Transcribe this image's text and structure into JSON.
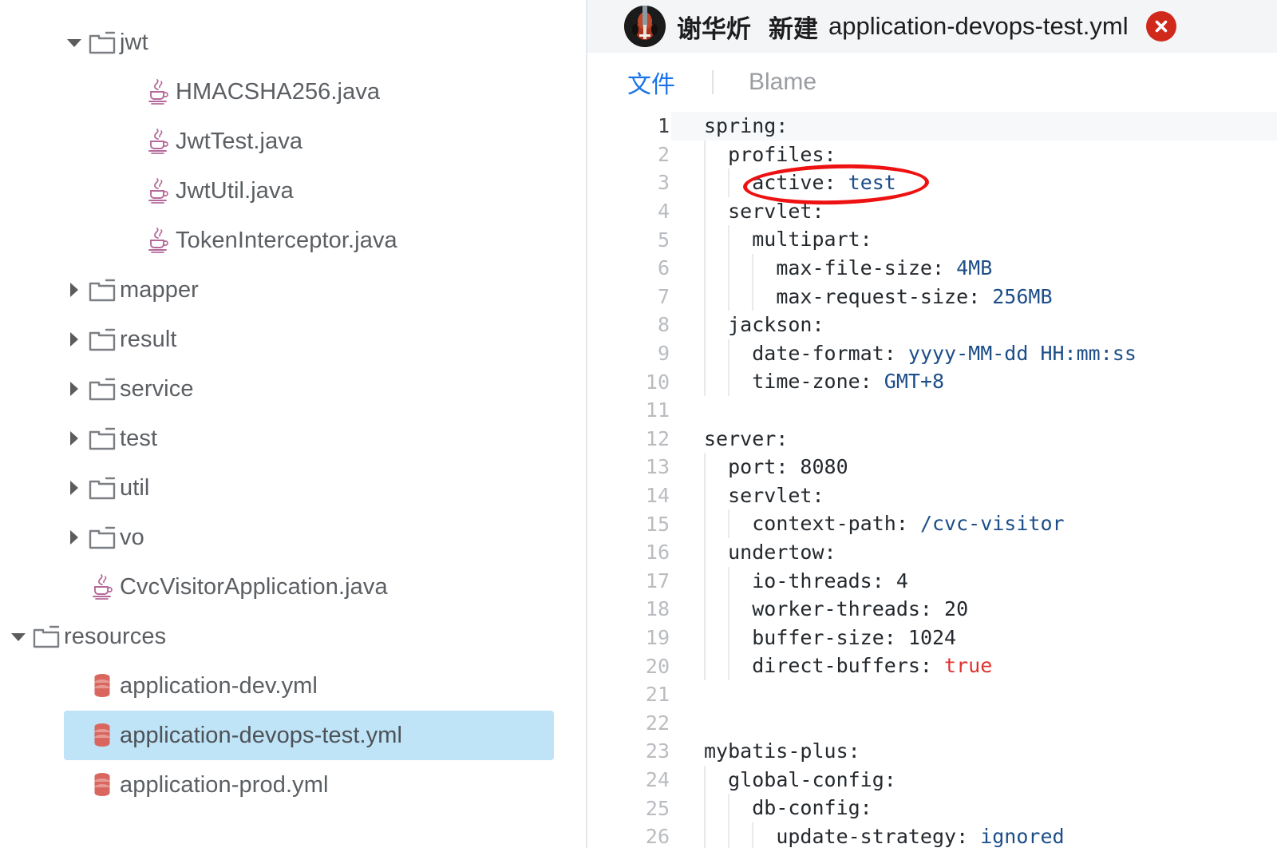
{
  "sidebar": {
    "rows": [
      {
        "id": "jwt",
        "label": "jwt",
        "kind": "folder",
        "twisty": "open",
        "depth": 1,
        "selected": false
      },
      {
        "id": "hmacsha256",
        "label": "HMACSHA256.java",
        "kind": "java",
        "twisty": "none",
        "depth": 2,
        "selected": false
      },
      {
        "id": "jwttest",
        "label": "JwtTest.java",
        "kind": "java",
        "twisty": "none",
        "depth": 2,
        "selected": false
      },
      {
        "id": "jwtutil",
        "label": "JwtUtil.java",
        "kind": "java",
        "twisty": "none",
        "depth": 2,
        "selected": false
      },
      {
        "id": "tokeninterceptor",
        "label": "TokenInterceptor.java",
        "kind": "java",
        "twisty": "none",
        "depth": 2,
        "selected": false
      },
      {
        "id": "mapper",
        "label": "mapper",
        "kind": "folder",
        "twisty": "closed",
        "depth": 1,
        "selected": false
      },
      {
        "id": "result",
        "label": "result",
        "kind": "folder",
        "twisty": "closed",
        "depth": 1,
        "selected": false
      },
      {
        "id": "service",
        "label": "service",
        "kind": "folder",
        "twisty": "closed",
        "depth": 1,
        "selected": false
      },
      {
        "id": "test",
        "label": "test",
        "kind": "folder",
        "twisty": "closed",
        "depth": 1,
        "selected": false
      },
      {
        "id": "util",
        "label": "util",
        "kind": "folder",
        "twisty": "closed",
        "depth": 1,
        "selected": false
      },
      {
        "id": "vo",
        "label": "vo",
        "kind": "folder",
        "twisty": "closed",
        "depth": 1,
        "selected": false
      },
      {
        "id": "cvcvisitorapp",
        "label": "CvcVisitorApplication.java",
        "kind": "java",
        "twisty": "none",
        "depth": 1,
        "selected": false
      },
      {
        "id": "resources",
        "label": "resources",
        "kind": "folder",
        "twisty": "open",
        "depth": 0,
        "selected": false
      },
      {
        "id": "app-dev",
        "label": "application-dev.yml",
        "kind": "yml",
        "twisty": "none",
        "depth": 1,
        "selected": false
      },
      {
        "id": "app-devops-test",
        "label": "application-devops-test.yml",
        "kind": "yml",
        "twisty": "none",
        "depth": 1,
        "selected": true
      },
      {
        "id": "app-prod",
        "label": "application-prod.yml",
        "kind": "yml",
        "twisty": "none",
        "depth": 1,
        "selected": false
      }
    ]
  },
  "header": {
    "user": "谢华炘",
    "action": "新建",
    "filename": "application-devops-test.yml",
    "avatar_icon": "violin-avatar",
    "close_icon": "close-circle-icon",
    "close_color": "#d0291c"
  },
  "tabs": {
    "items": [
      {
        "id": "file",
        "label": "文件",
        "active": true
      },
      {
        "id": "blame",
        "label": "Blame",
        "active": false
      }
    ],
    "active_color": "#1a73e8",
    "inactive_color": "#9a9da1"
  },
  "editor": {
    "language": "yaml",
    "highlighted_line": 1,
    "annotation": {
      "type": "ellipse",
      "color": "#ee1111",
      "targets_line": 3,
      "targets_text": "active: test"
    },
    "lines": [
      {
        "n": 1,
        "indent": 0,
        "tokens": [
          {
            "t": "spring:",
            "c": "plain"
          }
        ]
      },
      {
        "n": 2,
        "indent": 1,
        "tokens": [
          {
            "t": "profiles:",
            "c": "plain"
          }
        ]
      },
      {
        "n": 3,
        "indent": 2,
        "tokens": [
          {
            "t": "active: ",
            "c": "plain"
          },
          {
            "t": "test",
            "c": "str"
          }
        ]
      },
      {
        "n": 4,
        "indent": 1,
        "tokens": [
          {
            "t": "servlet:",
            "c": "plain"
          }
        ]
      },
      {
        "n": 5,
        "indent": 2,
        "tokens": [
          {
            "t": "multipart:",
            "c": "plain"
          }
        ]
      },
      {
        "n": 6,
        "indent": 3,
        "tokens": [
          {
            "t": "max-file-size: ",
            "c": "plain"
          },
          {
            "t": "4MB",
            "c": "str"
          }
        ]
      },
      {
        "n": 7,
        "indent": 3,
        "tokens": [
          {
            "t": "max-request-size: ",
            "c": "plain"
          },
          {
            "t": "256MB",
            "c": "str"
          }
        ]
      },
      {
        "n": 8,
        "indent": 1,
        "tokens": [
          {
            "t": "jackson:",
            "c": "plain"
          }
        ]
      },
      {
        "n": 9,
        "indent": 2,
        "tokens": [
          {
            "t": "date-format: ",
            "c": "plain"
          },
          {
            "t": "yyyy-MM-dd HH:mm:ss",
            "c": "str"
          }
        ]
      },
      {
        "n": 10,
        "indent": 2,
        "tokens": [
          {
            "t": "time-zone: ",
            "c": "plain"
          },
          {
            "t": "GMT+8",
            "c": "str"
          }
        ]
      },
      {
        "n": 11,
        "indent": 0,
        "tokens": []
      },
      {
        "n": 12,
        "indent": 0,
        "tokens": [
          {
            "t": "server:",
            "c": "plain"
          }
        ]
      },
      {
        "n": 13,
        "indent": 1,
        "tokens": [
          {
            "t": "port: ",
            "c": "plain"
          },
          {
            "t": "8080",
            "c": "num"
          }
        ]
      },
      {
        "n": 14,
        "indent": 1,
        "tokens": [
          {
            "t": "servlet:",
            "c": "plain"
          }
        ]
      },
      {
        "n": 15,
        "indent": 2,
        "tokens": [
          {
            "t": "context-path: ",
            "c": "plain"
          },
          {
            "t": "/cvc-visitor",
            "c": "str"
          }
        ]
      },
      {
        "n": 16,
        "indent": 1,
        "tokens": [
          {
            "t": "undertow:",
            "c": "plain"
          }
        ]
      },
      {
        "n": 17,
        "indent": 2,
        "tokens": [
          {
            "t": "io-threads: ",
            "c": "plain"
          },
          {
            "t": "4",
            "c": "num"
          }
        ]
      },
      {
        "n": 18,
        "indent": 2,
        "tokens": [
          {
            "t": "worker-threads: ",
            "c": "plain"
          },
          {
            "t": "20",
            "c": "num"
          }
        ]
      },
      {
        "n": 19,
        "indent": 2,
        "tokens": [
          {
            "t": "buffer-size: ",
            "c": "plain"
          },
          {
            "t": "1024",
            "c": "num"
          }
        ]
      },
      {
        "n": 20,
        "indent": 2,
        "tokens": [
          {
            "t": "direct-buffers: ",
            "c": "plain"
          },
          {
            "t": "true",
            "c": "bool"
          }
        ]
      },
      {
        "n": 21,
        "indent": 0,
        "tokens": []
      },
      {
        "n": 22,
        "indent": 0,
        "tokens": []
      },
      {
        "n": 23,
        "indent": 0,
        "tokens": [
          {
            "t": "mybatis-plus:",
            "c": "plain"
          }
        ]
      },
      {
        "n": 24,
        "indent": 1,
        "tokens": [
          {
            "t": "global-config:",
            "c": "plain"
          }
        ]
      },
      {
        "n": 25,
        "indent": 2,
        "tokens": [
          {
            "t": "db-config:",
            "c": "plain"
          }
        ]
      },
      {
        "n": 26,
        "indent": 3,
        "tokens": [
          {
            "t": "update-strategy: ",
            "c": "plain"
          },
          {
            "t": "ignored",
            "c": "str"
          }
        ]
      }
    ]
  }
}
